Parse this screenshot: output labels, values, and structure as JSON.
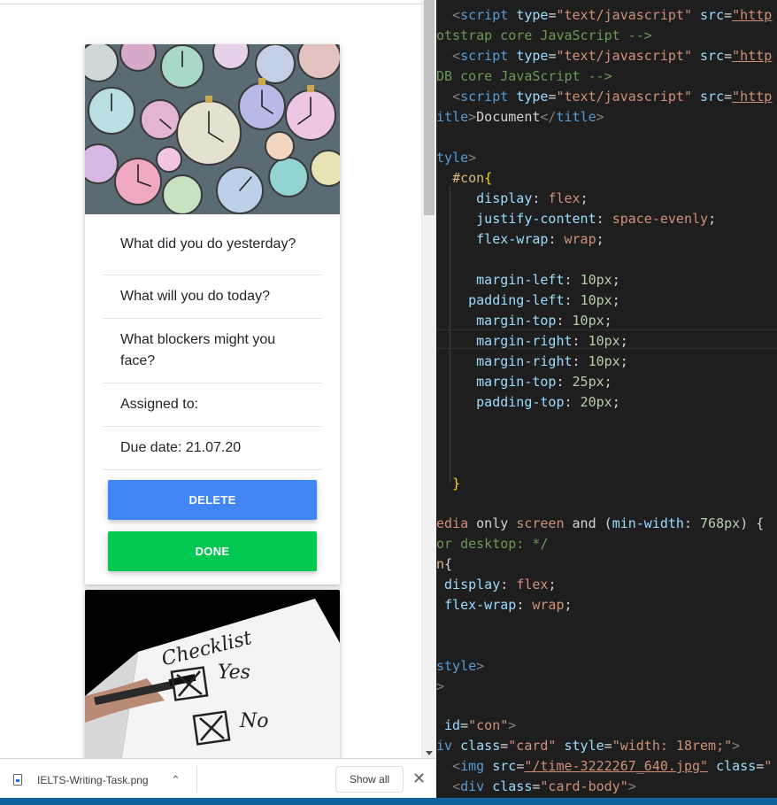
{
  "browser": {
    "cards": [
      {
        "image_name": "clocks-image",
        "items": [
          "What did you do yesterday?",
          "What will you do today?",
          "What blockers might you face?",
          "Assigned to:",
          "Due date: 21.07.20"
        ],
        "delete_label": "DELETE",
        "done_label": "DONE"
      },
      {
        "image_name": "checklist-image",
        "image_text": [
          "Checklist",
          "Yes",
          "No"
        ]
      }
    ],
    "colors": {
      "delete": "#4285f4",
      "done": "#00c851"
    }
  },
  "downloads": {
    "filename": "IELTS-Writing-Task.png",
    "show_all": "Show all"
  },
  "editor": {
    "lines": [
      "otstrap core JavaScript -->",
      "DB core JavaScript -->",
      "itle>Document</title>",
      "tyle>",
      "#con{",
      "display: flex;",
      "justify-content: space-evenly;",
      "flex-wrap: wrap;",
      "margin-left: 10px;",
      "padding-left: 10px;",
      "margin-top: 10px;",
      "margin-right: 10px;",
      "margin-right: 10px;",
      "margin-top: 25px;",
      "padding-top: 20px;",
      "}",
      "edia only screen and (min-width: 768px) {",
      "or desktop: */",
      "n{",
      "display: flex;",
      "flex-wrap: wrap;",
      "style>",
      "id=\"con\">",
      "iv class=\"card\" style=\"width: 18rem;\">",
      "<img src=\"/time-3222267_640.jpg\" class=\"",
      "<div class=\"card-body\">"
    ],
    "script_tag": "<script type=\"text/javascript\" src=\"http"
  }
}
